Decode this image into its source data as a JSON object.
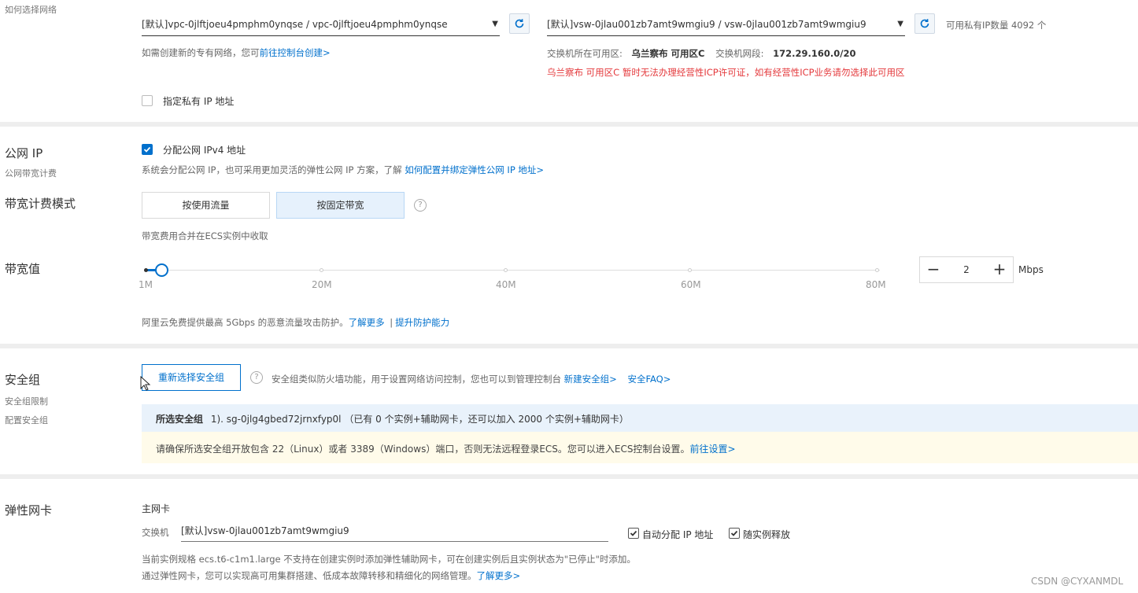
{
  "network": {
    "label": "如何选择网络",
    "vpc_select": "[默认]vpc-0jlftjoeu4pmphm0ynqse / vpc-0jlftjoeu4pmphm0ynqse",
    "vpc_hint": "如需创建新的专有网络，您可",
    "vpc_hint_link": "前往控制台创建>",
    "vswitch_select": "[默认]vsw-0jlau001zb7amt9wmgiu9 / vsw-0jlau001zb7amt9wmgiu9",
    "available_ip": "可用私有IP数量 4092 个",
    "zone_label": "交换机所在可用区:",
    "zone_value": "乌兰察布 可用区C",
    "cidr_label": "交换机网段:",
    "cidr_value": "172.29.160.0/20",
    "warning": "乌兰察布 可用区C 暂时无法办理经营性ICP许可证，如有经营性ICP业务请勿选择此可用区",
    "private_ip_checkbox": "指定私有 IP 地址"
  },
  "public_ip": {
    "title": "公网 IP",
    "subtitle": "公网带宽计费",
    "checkbox_label": "分配公网 IPv4 地址",
    "hint": "系统会分配公网 IP，也可采用更加灵活的弹性公网 IP 方案，了解",
    "hint_link": "如何配置并绑定弹性公网 IP 地址>",
    "billing_title": "带宽计费模式",
    "option_traffic": "按使用流量",
    "option_fixed": "按固定带宽",
    "help_icon": "?",
    "billing_hint": "带宽费用合并在ECS实例中收取",
    "bandwidth_title": "带宽值",
    "ticks": [
      "1M",
      "20M",
      "40M",
      "60M",
      "80M"
    ],
    "slider_min": 1,
    "slider_max": 80,
    "bandwidth_value": "2",
    "unit": "Mbps",
    "minus": "−",
    "plus": "+",
    "ddos_hint": "阿里云免费提供最高 5Gbps 的恶意流量攻击防护。",
    "ddos_link1": "了解更多",
    "ddos_sep": "|",
    "ddos_link2": "提升防护能力"
  },
  "security_group": {
    "title": "安全组",
    "sub1": "安全组限制",
    "sub2": "配置安全组",
    "reselect_button": "重新选择安全组",
    "help_icon": "?",
    "hint": "安全组类似防火墙功能，用于设置网络访问控制，您也可以到管理控制台",
    "link_new": "新建安全组>",
    "link_faq": "安全FAQ>",
    "selected_label": "所选安全组",
    "selected_value": "1). sg-0jlg4gbed72jrnxfyp0l （已有 0 个实例+辅助网卡，还可以加入 2000 个实例+辅助网卡）",
    "notice": "请确保所选安全组开放包含 22（Linux）或者 3389（Windows）端口，否则无法远程登录ECS。您可以进入ECS控制台设置。",
    "notice_link": "前往设置>"
  },
  "eni": {
    "title": "弹性网卡",
    "primary_label": "主网卡",
    "vswitch_label": "交换机",
    "vswitch_value": "[默认]vsw-0jlau001zb7amt9wmgiu9",
    "auto_ip": "自动分配 IP 地址",
    "release_with": "随实例释放",
    "note1": "当前实例规格 ecs.t6-c1m1.large 不支持在创建实例时添加弹性辅助网卡，可在创建实例后且实例状态为\"已停止\"时添加。",
    "note2": "通过弹性网卡，您可以实现高可用集群搭建、低成本故障转移和精细化的网络管理。",
    "note2_link": "了解更多>"
  },
  "watermark": "CSDN @CYXANMDL",
  "colors": {
    "accent": "#0070cc",
    "warning": "#e4393c",
    "divider": "#eeeeee"
  }
}
